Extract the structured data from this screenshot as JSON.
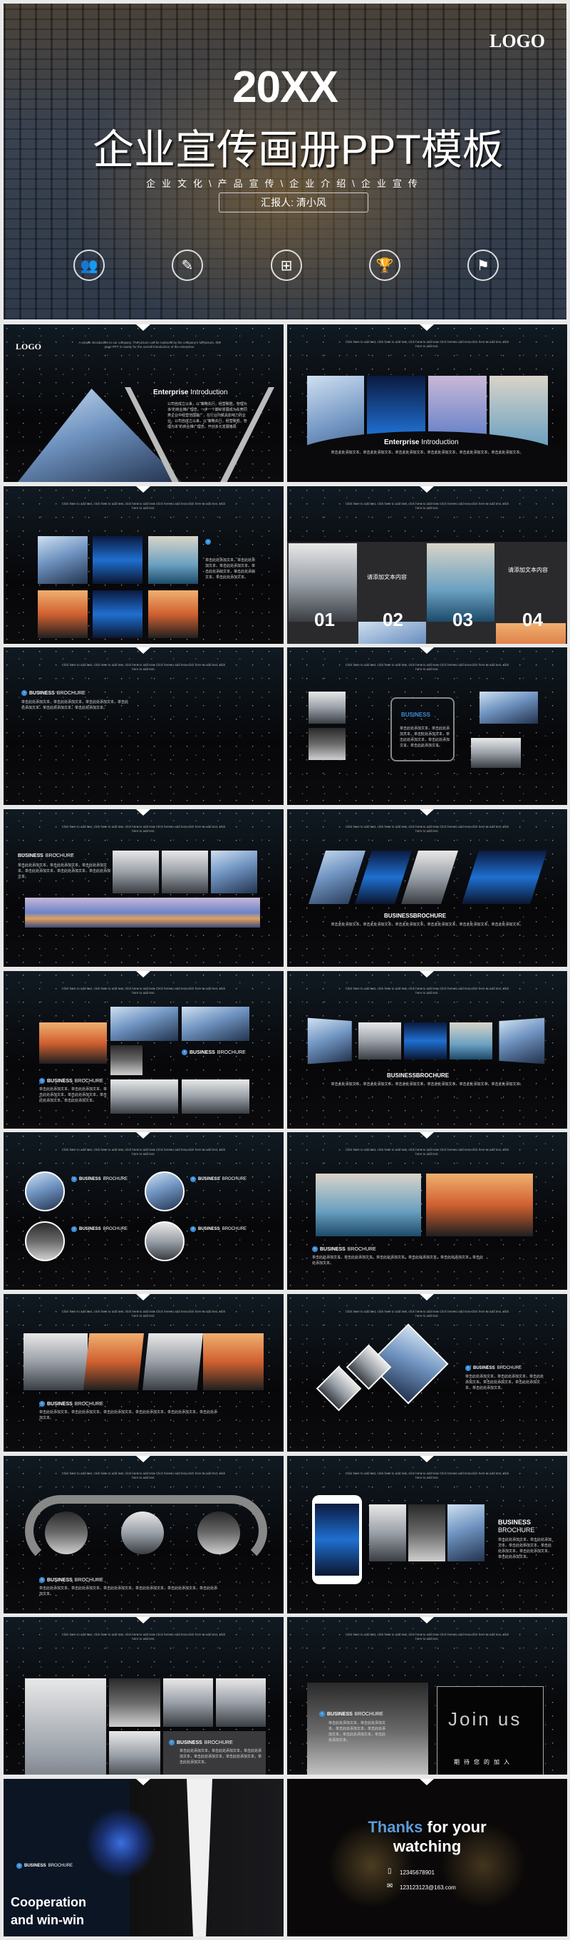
{
  "cover": {
    "logo": "LOGO",
    "year": "20XX",
    "title": "企业宣传画册PPT模板",
    "subtitle": "企业文化\\产品宣传\\企业介绍\\企业宣传",
    "reporter": "汇报人: 清小风",
    "icons": [
      "people-icon",
      "edit-icon",
      "org-chart-icon",
      "trophy-icon",
      "flag-icon"
    ]
  },
  "common": {
    "caption": "Click here to add text, click here to add text, click here to add text. Click here to add text, click here to add text, click here to add text.",
    "body": "单击此处添加文本，单击此处添加文本，单击此处添加文本，单击此处添加文本，单击此处添加文本，单击此处添加文本。",
    "bb": "BUSINESS",
    "bb2": "BROCHURE",
    "bb_joined": "BUSINESSBROCHURE",
    "ent": "Enterprise",
    "intro": "Introduction"
  },
  "slide1": {
    "logo": "LOGO",
    "caption": "A simple introduction to our company. The picture can be replaced by the company's full picture, this page PPT is mainly for the overall introduction of the enterprise.",
    "body": "公司自成立以来，以\"策略先行，经营致胜，管理为本\"的商业推广理念，一步一个脚印发展成为东莞同类企业中经营范围最广，在行业内颇具影响力的企业。公司自成立以来，以\"策略先行，经营致胜，管理为本\"的商业推广理念，开创多元发展格局"
  },
  "slide4": {
    "items": [
      "请添加文本内容",
      "请添加文本内容",
      "请添加文本内容",
      "请添加文本内容"
    ],
    "nums": [
      "01",
      "02",
      "03",
      "04"
    ],
    "small": "Click here to add text, click here to add text"
  },
  "slide18": {
    "join": "Join us",
    "join_sub": "期待您的加入"
  },
  "slide19": {
    "line1": "Cooperation",
    "line2": "and win-win"
  },
  "slide20": {
    "thanks": "Thanks",
    "rest1": "for your",
    "rest2": "watching",
    "phone": "12345678901",
    "email": "123123123@163.com"
  },
  "colors": {
    "accent": "#3b8fd8",
    "background": "#070709"
  }
}
